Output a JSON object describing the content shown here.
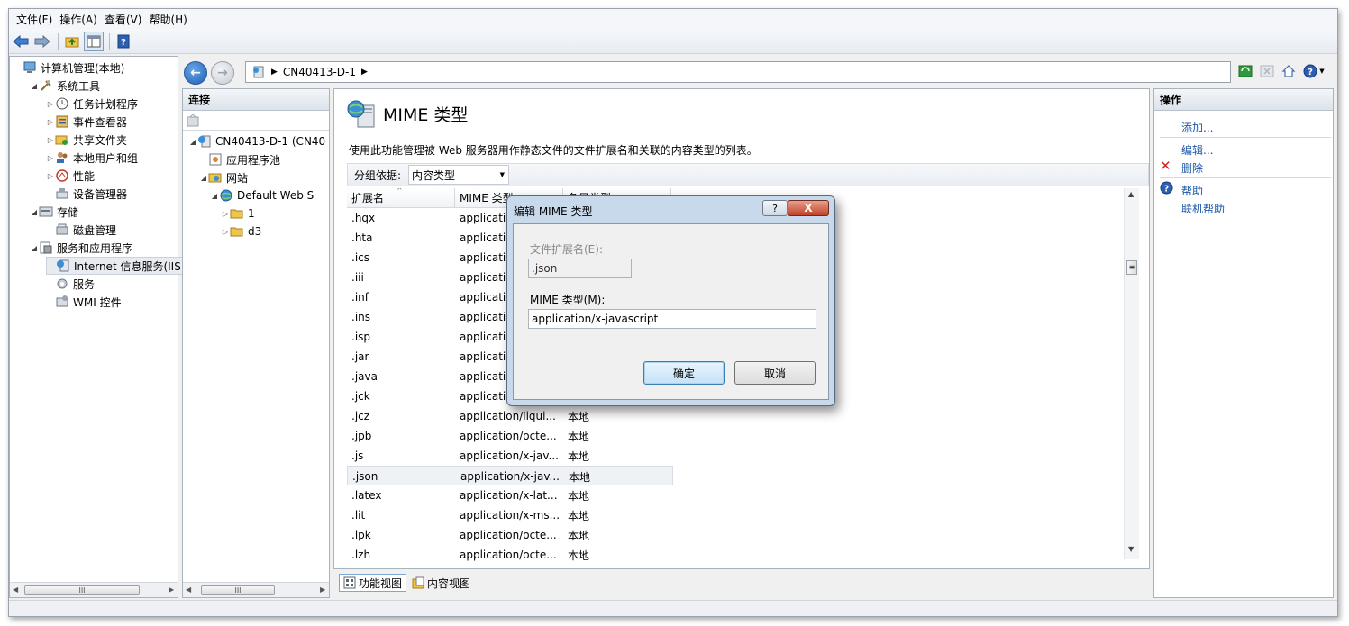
{
  "menu": [
    "文件(F)",
    "操作(A)",
    "查看(V)",
    "帮助(H)"
  ],
  "left_tree": [
    {
      "label": "计算机管理(本地)",
      "indent": 0,
      "tri": "",
      "icon": "computer-icon"
    },
    {
      "label": "系统工具",
      "indent": 1,
      "tri": "◢",
      "icon": "tools-icon"
    },
    {
      "label": "任务计划程序",
      "indent": 2,
      "tri": "▷",
      "icon": "clock-icon"
    },
    {
      "label": "事件查看器",
      "indent": 2,
      "tri": "▷",
      "icon": "event-viewer-icon"
    },
    {
      "label": "共享文件夹",
      "indent": 2,
      "tri": "▷",
      "icon": "shared-folder-icon"
    },
    {
      "label": "本地用户和组",
      "indent": 2,
      "tri": "▷",
      "icon": "users-icon"
    },
    {
      "label": "性能",
      "indent": 2,
      "tri": "▷",
      "icon": "performance-icon"
    },
    {
      "label": "设备管理器",
      "indent": 2,
      "tri": "",
      "icon": "device-manager-icon"
    },
    {
      "label": "存储",
      "indent": 1,
      "tri": "◢",
      "icon": "storage-icon"
    },
    {
      "label": "磁盘管理",
      "indent": 2,
      "tri": "",
      "icon": "disk-icon"
    },
    {
      "label": "服务和应用程序",
      "indent": 1,
      "tri": "◢",
      "icon": "services-apps-icon"
    },
    {
      "label": "Internet 信息服务(IIS)管",
      "indent": 2,
      "tri": "",
      "icon": "iis-icon",
      "selected": true
    },
    {
      "label": "服务",
      "indent": 2,
      "tri": "",
      "icon": "gear-icon"
    },
    {
      "label": "WMI 控件",
      "indent": 2,
      "tri": "",
      "icon": "wmi-icon"
    }
  ],
  "address": {
    "crumb": "CN40413-D-1"
  },
  "connections": {
    "title": "连接",
    "tree": [
      {
        "label": "CN40413-D-1 (CN40",
        "indent": 0,
        "tri": "◢",
        "icon": "server-icon"
      },
      {
        "label": "应用程序池",
        "indent": 1,
        "tri": "",
        "icon": "app-pool-icon"
      },
      {
        "label": "网站",
        "indent": 1,
        "tri": "◢",
        "icon": "sites-icon"
      },
      {
        "label": "Default Web S",
        "indent": 2,
        "tri": "◢",
        "icon": "globe-icon"
      },
      {
        "label": "1",
        "indent": 3,
        "tri": "▷",
        "icon": "folder-icon"
      },
      {
        "label": "d3",
        "indent": 3,
        "tri": "▷",
        "icon": "folder-icon"
      }
    ]
  },
  "feature": {
    "title": "MIME 类型",
    "description": "使用此功能管理被 Web 服务器用作静态文件的文件扩展名和关联的内容类型的列表。",
    "group_label": "分组依据:",
    "group_value": "内容类型",
    "columns": [
      "扩展名",
      "MIME 类型",
      "条目类型"
    ],
    "rows": [
      [
        ".hqx",
        "applicatio",
        ""
      ],
      [
        ".hta",
        "applicatio",
        ""
      ],
      [
        ".ics",
        "applicatio",
        ""
      ],
      [
        ".iii",
        "applicatio",
        ""
      ],
      [
        ".inf",
        "applicatio",
        ""
      ],
      [
        ".ins",
        "applicatio",
        ""
      ],
      [
        ".isp",
        "applicatio",
        ""
      ],
      [
        ".jar",
        "applicatio",
        ""
      ],
      [
        ".java",
        "applicatio",
        ""
      ],
      [
        ".jck",
        "applicatio",
        ""
      ],
      [
        ".jcz",
        "application/liqui...",
        "本地"
      ],
      [
        ".jpb",
        "application/octe...",
        "本地"
      ],
      [
        ".js",
        "application/x-jav...",
        "本地"
      ],
      [
        ".json",
        "application/x-jav...",
        "本地"
      ],
      [
        ".latex",
        "application/x-lat...",
        "本地"
      ],
      [
        ".lit",
        "application/x-ms...",
        "本地"
      ],
      [
        ".lpk",
        "application/octe...",
        "本地"
      ],
      [
        ".lzh",
        "application/octe...",
        "本地"
      ]
    ],
    "selected_row": 13
  },
  "bottom_tabs": [
    "功能视图",
    "内容视图"
  ],
  "actions": {
    "title": "操作",
    "items": [
      "添加...",
      "编辑...",
      "删除",
      "帮助",
      "联机帮助"
    ]
  },
  "dialog": {
    "title": "编辑 MIME 类型",
    "help": "?",
    "close": "X",
    "ext_label": "文件扩展名(E):",
    "ext_value": ".json",
    "mime_label": "MIME 类型(M):",
    "mime_value": "application/x-javascript",
    "ok": "确定",
    "cancel": "取消"
  },
  "scroll": {
    "thumb": "III"
  },
  "colors": {
    "link": "#1a56a8",
    "delete": "#d0241c"
  }
}
